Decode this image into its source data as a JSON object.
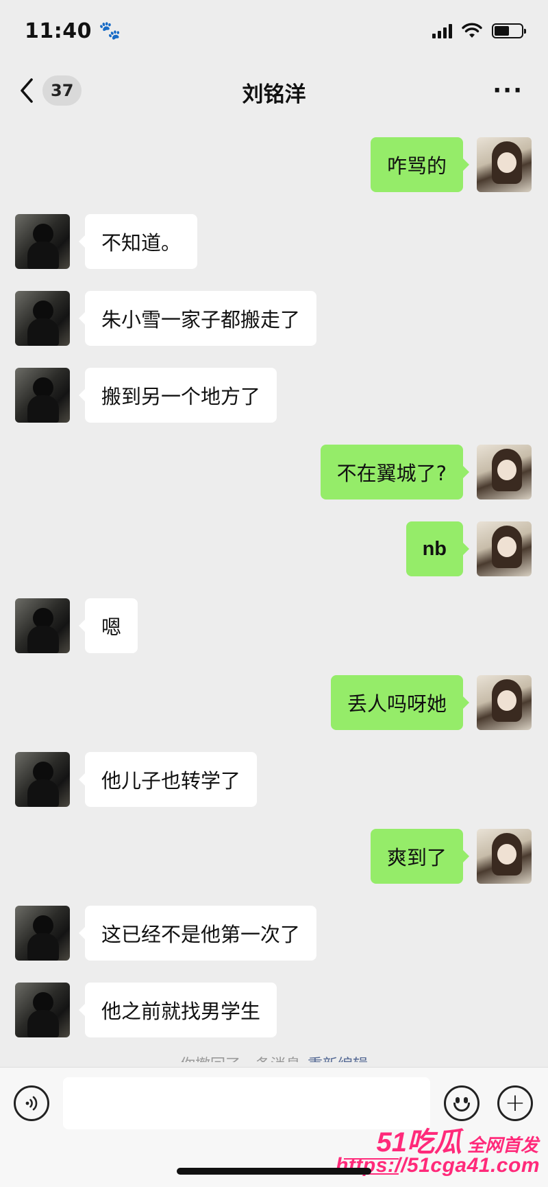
{
  "status_bar": {
    "time": "11:40",
    "paw_icon": "🐾",
    "signal_icon": "cellular-signal",
    "wifi_icon": "wifi",
    "battery_icon": "battery"
  },
  "nav": {
    "unread_count": "37",
    "title": "刘铭洋",
    "more": "···"
  },
  "messages": [
    {
      "side": "right",
      "text": "咋骂的"
    },
    {
      "side": "left",
      "text": "不知道。"
    },
    {
      "side": "left",
      "text": "朱小雪一家子都搬走了"
    },
    {
      "side": "left",
      "text": "搬到另一个地方了"
    },
    {
      "side": "right",
      "text": "不在翼城了?"
    },
    {
      "side": "right",
      "text": "nb"
    },
    {
      "side": "left",
      "text": "嗯"
    },
    {
      "side": "right",
      "text": "丢人吗呀她"
    },
    {
      "side": "left",
      "text": "他儿子也转学了"
    },
    {
      "side": "right",
      "text": "爽到了"
    },
    {
      "side": "left",
      "text": "这已经不是他第一次了"
    },
    {
      "side": "left",
      "text": "他之前就找男学生"
    }
  ],
  "recall_note": {
    "text": "你撤回了一条消息",
    "action": "重新编辑"
  },
  "input_bar": {
    "voice_icon": "voice-icon",
    "emoji_icon": "emoji-icon",
    "plus_icon": "plus-icon",
    "plus_glyph": "+"
  },
  "watermark": {
    "brand": "51吃瓜",
    "slogan": "全网首发",
    "url": "https://51cga41.com"
  },
  "colors": {
    "background": "#ededed",
    "own_bubble": "#95ec69",
    "other_bubble": "#ffffff",
    "link": "#576b95",
    "watermark": "#ff2a7a"
  }
}
